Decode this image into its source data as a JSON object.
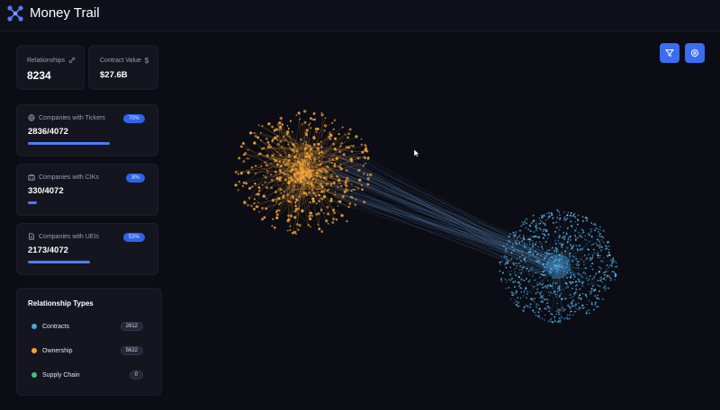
{
  "app": {
    "title": "Money Trail",
    "logo_icon": "network-nodes-icon"
  },
  "stats": {
    "relationships": {
      "label": "Relationships",
      "value": "8234",
      "icon": "link-icon"
    },
    "contract_value": {
      "label": "Contract Value",
      "value": "$27.6B",
      "icon": "dollar-icon"
    }
  },
  "coverage": [
    {
      "label": "Companies with Tickers",
      "value": "2836/4072",
      "badge": "70%",
      "fraction": 0.7,
      "icon": "globe-icon"
    },
    {
      "label": "Companies with CIKs",
      "value": "330/4072",
      "badge": "8%",
      "fraction": 0.08,
      "icon": "building-icon"
    },
    {
      "label": "Companies with UEIs",
      "value": "2173/4072",
      "badge": "53%",
      "fraction": 0.53,
      "icon": "document-icon"
    }
  ],
  "relationship_types": {
    "title": "Relationship Types",
    "items": [
      {
        "label": "Contracts",
        "count": "2612",
        "color": "#4aa3e0"
      },
      {
        "label": "Ownership",
        "count": "5622",
        "color": "#f0a33a"
      },
      {
        "label": "Supply Chain",
        "count": "0",
        "color": "#3cc486"
      }
    ]
  },
  "toolbar": {
    "filter_icon": "filter-icon",
    "settings_icon": "settings-icon"
  },
  "colors": {
    "accent": "#3c6cf0",
    "ownership": "#f0a33a",
    "contracts": "#4aa3e0",
    "background": "#0b0c14"
  }
}
